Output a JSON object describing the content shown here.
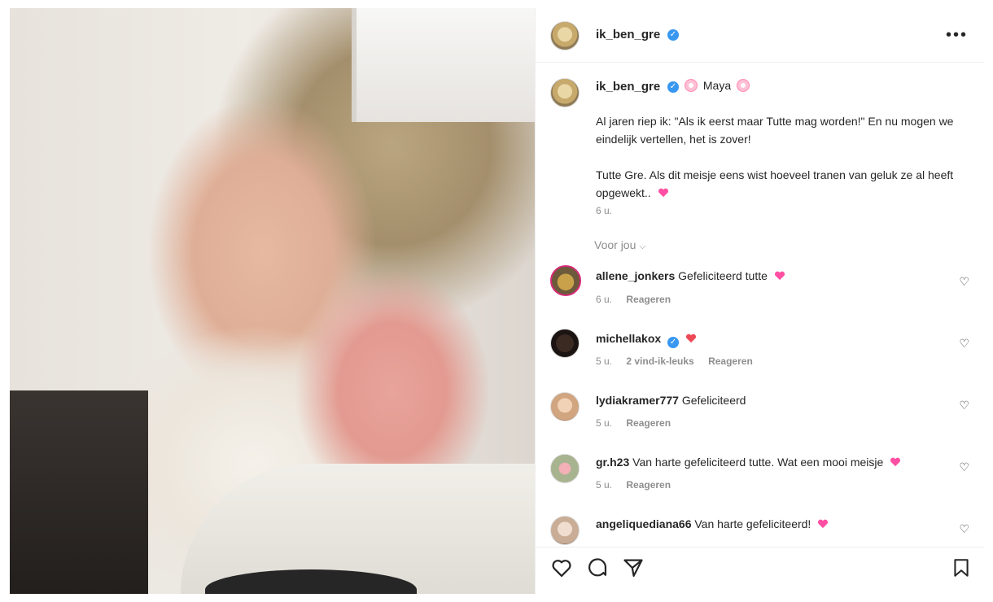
{
  "post": {
    "username": "ik_ben_gre",
    "more_label": "•••"
  },
  "caption": {
    "username": "ik_ben_gre",
    "name": "Maya",
    "paragraph1": "Al jaren riep ik: \"Als ik eerst maar Tutte mag worden!\" En nu mogen we eindelijk vertellen, het is zover!",
    "paragraph2": "Tutte Gre. Als dit meisje eens wist hoeveel tranen van geluk ze al heeft opgewekt..",
    "time": "6 u."
  },
  "for_you_label": "Voor jou",
  "comments": [
    {
      "username": "allene_jonkers",
      "text": "Gefeliciteerd tutte",
      "time": "6 u.",
      "likes": "",
      "reply": "Reageren",
      "emoji": "pink-hearts"
    },
    {
      "username": "michellakox",
      "text": "",
      "time": "5 u.",
      "likes": "2 vind-ik-leuks",
      "reply": "Reageren",
      "emoji": "red-heart",
      "verified": true
    },
    {
      "username": "lydiakramer777",
      "text": "Gefeliciteerd",
      "time": "5 u.",
      "likes": "",
      "reply": "Reageren"
    },
    {
      "username": "gr.h23",
      "text": "Van harte gefeliciteerd tutte. Wat een mooi meisje",
      "time": "5 u.",
      "likes": "",
      "reply": "Reageren",
      "emoji": "pink-heart"
    },
    {
      "username": "angeliquediana66",
      "text": "Van harte gefeliciteerd!",
      "time": "",
      "likes": "",
      "reply": "",
      "emoji": "pink-heart"
    }
  ],
  "colors": {
    "verified": "#3897f0",
    "muted_text": "#8e8e8e",
    "pink_heart": "#ff4fa3",
    "red_heart": "#ed4956"
  },
  "icons": [
    "heart-icon",
    "comment-icon",
    "share-icon",
    "bookmark-icon",
    "verified-badge-icon",
    "more-icon"
  ]
}
